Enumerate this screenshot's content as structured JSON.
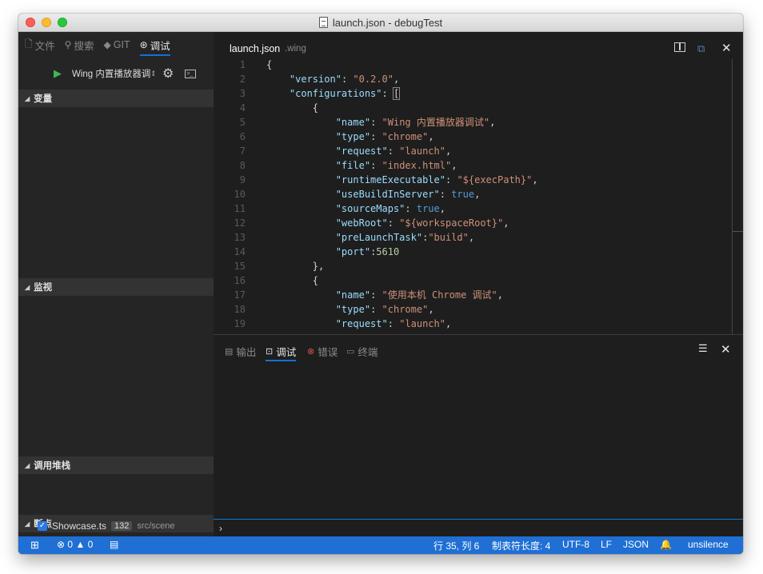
{
  "window": {
    "title": "launch.json - debugTest"
  },
  "sidebar": {
    "tabs": [
      {
        "label": "文件",
        "icon": "file-icon"
      },
      {
        "label": "搜索",
        "icon": "search-icon"
      },
      {
        "label": "GIT",
        "icon": "git-icon"
      },
      {
        "label": "调试",
        "icon": "debug-icon"
      }
    ],
    "debug_config": "Wing 内置播放器调",
    "sections": {
      "variables": "变量",
      "watch": "监视",
      "callstack": "调用堆栈",
      "breakpoints": "断点"
    },
    "breakpoint": {
      "file": "Showcase.ts",
      "line": "132",
      "path": "src/scene"
    }
  },
  "editor": {
    "tab_name": "launch.json",
    "tab_ext": ".wing",
    "lines": [
      "1",
      "2",
      "3",
      "4",
      "5",
      "6",
      "7",
      "8",
      "9",
      "10",
      "11",
      "12",
      "13",
      "14",
      "15",
      "16",
      "17",
      "18",
      "19"
    ],
    "code": {
      "l1": "{",
      "version_key": "\"version\"",
      "version_val": "\"0.2.0\"",
      "configs_key": "\"configurations\"",
      "obj_open": "{",
      "name_key": "\"name\"",
      "name_val1": "\"Wing 内置播放器调试\"",
      "type_key": "\"type\"",
      "type_val": "\"chrome\"",
      "request_key": "\"request\"",
      "request_val": "\"launch\"",
      "file_key": "\"file\"",
      "file_val": "\"index.html\"",
      "runtime_key": "\"runtimeExecutable\"",
      "runtime_val": "\"${execPath}\"",
      "usebuild_key": "\"useBuildInServer\"",
      "true_val": "true",
      "sourcemaps_key": "\"sourceMaps\"",
      "webroot_key": "\"webRoot\"",
      "webroot_val": "\"${workspaceRoot}\"",
      "prelaunch_key": "\"preLaunchTask\"",
      "prelaunch_val": "\"build\"",
      "port_key": "\"port\"",
      "port_val": "5610",
      "obj_close": "},",
      "name_val2": "\"使用本机 Chrome 调试\""
    }
  },
  "panel": {
    "tabs": [
      {
        "label": "输出"
      },
      {
        "label": "调试"
      },
      {
        "label": "错误"
      },
      {
        "label": "终端"
      }
    ],
    "prompt": "›"
  },
  "status": {
    "errors": "0",
    "warnings": "0",
    "position": "行 35, 列 6",
    "tabsize": "制表符长度: 4",
    "encoding": "UTF-8",
    "eol": "LF",
    "language": "JSON",
    "user": "unsilence"
  },
  "colors": {
    "accent": "#1f6fd4",
    "sidebar": "#252526",
    "editor": "#1e1e1e"
  }
}
